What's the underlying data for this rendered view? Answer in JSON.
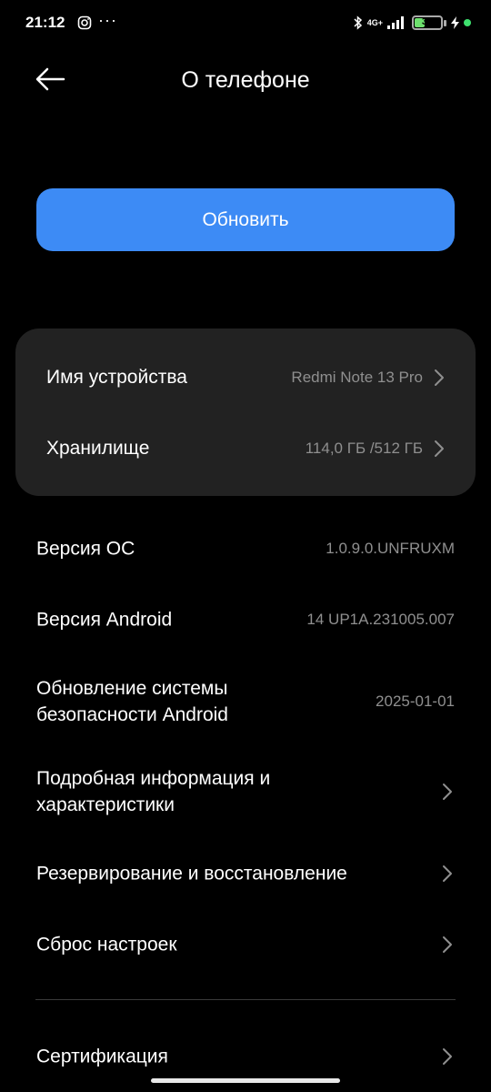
{
  "status_bar": {
    "time": "21:12",
    "more": "···",
    "network": "4G+",
    "battery_text": "39",
    "battery_level": 0.39
  },
  "header": {
    "title": "О телефоне"
  },
  "update_button": {
    "label": "Обновить",
    "color": "#3d8bf5"
  },
  "card": {
    "device_name": {
      "label": "Имя устройства",
      "value": "Redmi Note 13 Pro"
    },
    "storage": {
      "label": "Хранилище",
      "value": "114,0 ГБ /512 ГБ"
    }
  },
  "info": {
    "os_version": {
      "label": "Версия ОС",
      "value": "1.0.9.0.UNFRUXM"
    },
    "android_version": {
      "label": "Версия Android",
      "value": "14 UP1A.231005.007"
    },
    "security_update": {
      "label_line1": "Обновление системы",
      "label_line2": "безопасности Android",
      "value": "2025-01-01"
    },
    "details": {
      "label_line1": "Подробная информация и",
      "label_line2": "характеристики"
    },
    "backup": {
      "label": "Резервирование и восстановление"
    },
    "reset": {
      "label": "Сброс настроек"
    },
    "certification": {
      "label": "Сертификация"
    }
  }
}
